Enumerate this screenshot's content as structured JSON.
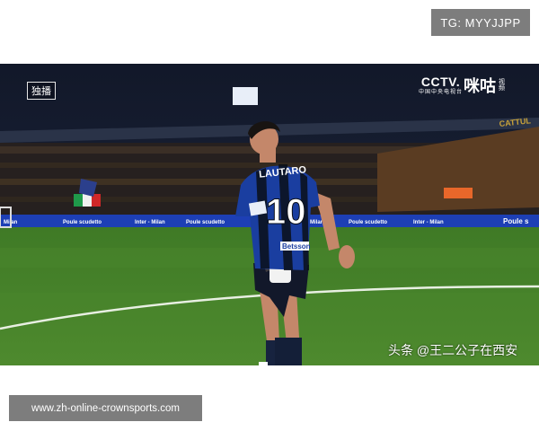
{
  "top_badge": "TG: MYYJJPP",
  "video": {
    "exclusive_label": "独播",
    "cctv_logo": {
      "main": "CCTV.",
      "sub": "中国中央电视台"
    },
    "migu_logo": {
      "main": "咪咕",
      "sub": "视频"
    },
    "jersey_name": "LAUTARO",
    "jersey_number": "10",
    "jersey_sponsor": "Betsson",
    "board_texts": [
      "Milan",
      "Poule scudetto",
      "Inter - Milan",
      "Poule scudetto",
      "Milan",
      "Poule scudetto",
      "Inter - Milan",
      "Poule s"
    ],
    "upper_board": "CATTUL",
    "watermark": "头条 @王二公子在西安"
  },
  "bottom_url": "www.zh-online-crownsports.com",
  "colors": {
    "pitch": "#4e8a2e",
    "inter_blue": "#1a3ea0",
    "board_blue": "#1d3fb5",
    "grey_bar": "#7d7d7d"
  }
}
